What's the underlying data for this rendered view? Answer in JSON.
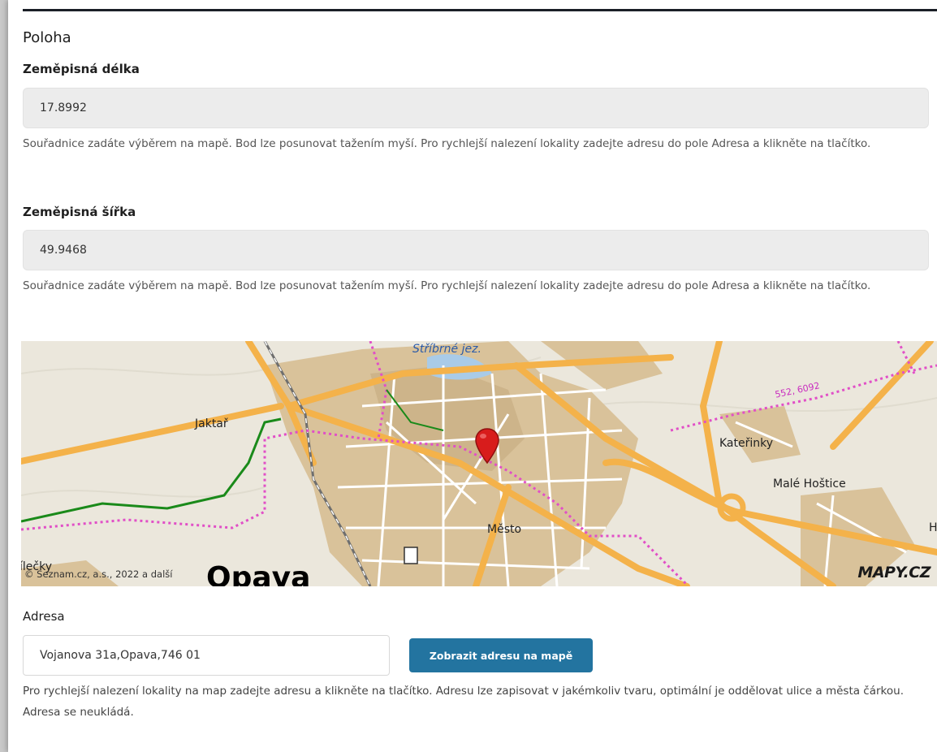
{
  "section": {
    "title": "Poloha"
  },
  "longitude": {
    "label": "Zeměpisná délka",
    "value": "17.8992",
    "help": "Souřadnice zadáte výběrem na mapě. Bod lze posunovat tažením myší. Pro rychlejší nalezení lokality zadejte adresu do pole Adresa a klikněte na tlačítko."
  },
  "latitude": {
    "label": "Zeměpisná šířka",
    "value": "49.9468",
    "help": "Souřadnice zadáte výběrem na mapě. Bod lze posunovat tažením myší. Pro rychlejší nalezení lokality zadejte adresu do pole Adresa a klikněte na tlačítko."
  },
  "map": {
    "labels": {
      "lake": "Stříbrné jez.",
      "route": "552, 6092",
      "jaktar": "Jaktař",
      "katerinky": "Kateřinky",
      "male_hostice": "Malé Hoštice",
      "mesto": "Město",
      "edge_left": "ílečky",
      "edge_right": "H",
      "city": "Opava"
    },
    "copyright": "© Seznam.cz, a.s., 2022 a další",
    "brand": "MAPY.CZ",
    "colors": {
      "road": "#f4b24a",
      "urban": "#d9c29a",
      "route": "#e14fc7",
      "marker": "#d81c1c",
      "trail": "#1a8a1a",
      "water": "#a9cbe8"
    }
  },
  "address": {
    "label": "Adresa",
    "value": "Vojanova 31a,Opava,746 01",
    "button_label": "Zobrazit adresu na mapě",
    "help": "Pro rychlejší nalezení lokality na map zadejte adresu a klikněte na tlačítko. Adresu lze zapisovat v jakémkoliv tvaru, optimální je oddělovat ulice a města čárkou. Adresa se neukládá."
  }
}
